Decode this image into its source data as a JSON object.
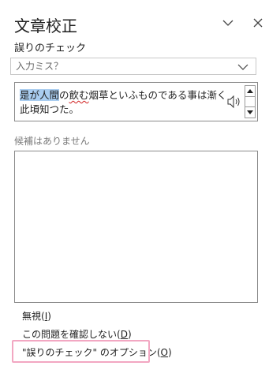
{
  "pane": {
    "title": "文章校正",
    "collapse_icon": "chevron-down-icon",
    "close_icon": "close-icon"
  },
  "check": {
    "section_title": "誤りのチェック",
    "category_value": "入力ミス？",
    "sentence": {
      "highlighted": "是が人間",
      "part2": "の",
      "error": "飲む",
      "part3": "烟草といふものである事は漸く此頃知つた。"
    },
    "speaker_icon": "speaker-icon",
    "scroll_up_icon": "scroll-up-icon",
    "scroll_down_icon": "scroll-down-icon"
  },
  "suggestions": {
    "label": "候補はありません",
    "items": []
  },
  "actions": {
    "ignore_prefix": "無視(",
    "ignore_key": "I",
    "ignore_suffix": ")",
    "ignore_all_prefix": "この問題を確認しない(",
    "ignore_all_key": "D",
    "ignore_all_suffix": ")",
    "options_prefix": "\"誤りのチェック\" のオプション(",
    "options_key": "O",
    "options_suffix": ")"
  },
  "colors": {
    "highlight": "#a9cdf0",
    "error_underline": "#d02020",
    "annotation_frame": "#f2a7c2"
  }
}
